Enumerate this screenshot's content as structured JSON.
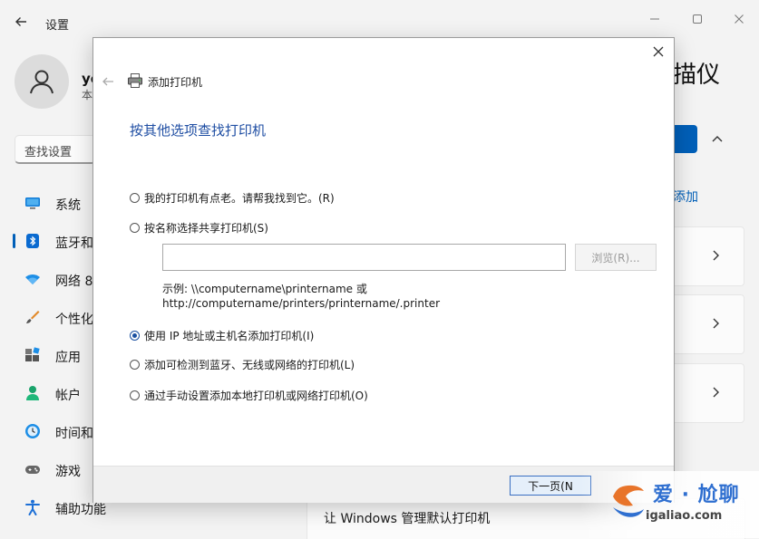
{
  "settings": {
    "title": "设置",
    "user": {
      "name": "ye",
      "sub": "本"
    },
    "search_placeholder": "查找设置",
    "nav": [
      {
        "label": "系统",
        "icon": "monitor-icon"
      },
      {
        "label": "蓝牙和",
        "icon": "bluetooth-icon",
        "active": true
      },
      {
        "label": "网络 8",
        "icon": "wifi-icon"
      },
      {
        "label": "个性化",
        "icon": "brush-icon"
      },
      {
        "label": "应用",
        "icon": "apps-icon"
      },
      {
        "label": "帐户",
        "icon": "account-icon"
      },
      {
        "label": "时间和",
        "icon": "clock-icon"
      },
      {
        "label": "游戏",
        "icon": "gamepad-icon"
      },
      {
        "label": "辅助功能",
        "icon": "accessibility-icon"
      }
    ],
    "page_title": "描仪",
    "add_link": "添加",
    "bottom_card": "让 Windows 管理默认打印机",
    "accent": "#005fb8"
  },
  "dialog": {
    "title": "添加打印机",
    "heading": "按其他选项查找打印机",
    "options": [
      {
        "label": "我的打印机有点老。请帮我找到它。(R)",
        "checked": false
      },
      {
        "label": "按名称选择共享打印机(S)",
        "checked": false
      },
      {
        "label": "使用 IP 地址或主机名添加打印机(I)",
        "checked": true
      },
      {
        "label": "添加可检测到蓝牙、无线或网络的打印机(L)",
        "checked": false
      },
      {
        "label": "通过手动设置添加本地打印机或网络打印机(O)",
        "checked": false
      }
    ],
    "share_input_value": "",
    "browse_label": "浏览(R)...",
    "example_line1": "示例: \\\\computername\\printername 或",
    "example_line2": "http://computername/printers/printername/.printer",
    "next_label": "下一页(N"
  },
  "watermark": {
    "text": "爱 · 尬聊",
    "url": "igaliao.com"
  }
}
